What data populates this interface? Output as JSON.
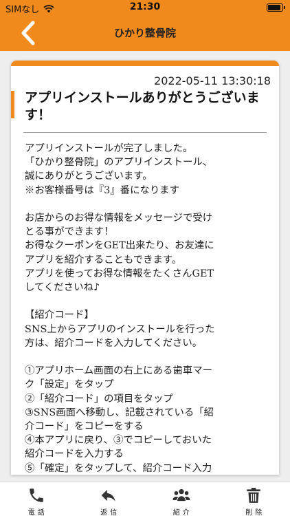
{
  "status": {
    "carrier": "SIMなし",
    "time": "21:30"
  },
  "header": {
    "title": "ひかり整骨院"
  },
  "message": {
    "date": "2022-05-11 13:30:18",
    "title": "アプリインストールありがとうございます！",
    "lines": [
      "アプリインストールが完了しました。",
      "「ひかり整骨院」のアプリインストール、",
      "誠にありがとうございます。",
      "※お客様番号は『3』番になります",
      "",
      "お店からのお得な情報をメッセージで受け",
      "とる事ができます！",
      "お得なクーポンをGET出来たり、お友達に",
      "アプリを紹介することもできます。",
      "アプリを使ってお得な情報をたくさんGET",
      "してくださいね♪",
      "",
      "【紹介コード】",
      "SNS上からアプリのインストールを行った",
      "方は、紹介コードを入力してください。",
      "",
      "①アプリホーム画面の右上にある歯車マー",
      "ク「設定」をタップ",
      "②「紹介コード」の項目をタップ",
      "③SNS画面へ移動し、記載されている「紹",
      "介コード」をコピーをする",
      "④本アプリに戻り、③でコピーしておいた",
      "紹介コードを入力する",
      "⑤「確定」をタップして、紹介コード入力"
    ]
  },
  "tabs": [
    {
      "label": "電話",
      "icon": "phone-icon"
    },
    {
      "label": "返信",
      "icon": "reply-icon"
    },
    {
      "label": "紹介",
      "icon": "users-icon"
    },
    {
      "label": "削除",
      "icon": "trash-icon"
    }
  ],
  "colors": {
    "accent": "#f18a1c",
    "tab_icon": "#333333"
  }
}
